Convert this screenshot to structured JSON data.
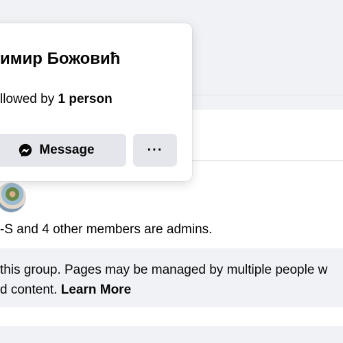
{
  "hover_card": {
    "name": "имир Божовић",
    "followed_prefix": "llowed by ",
    "followed_count": "1 person",
    "message_label": "Message",
    "more_label": "···"
  },
  "group_about": {
    "admins_text": "-S and 4 other members are admins.",
    "info_line1": "this group. Pages may be managed by multiple people w",
    "info_line2_prefix": "d content. ",
    "learn_more": "Learn More"
  }
}
